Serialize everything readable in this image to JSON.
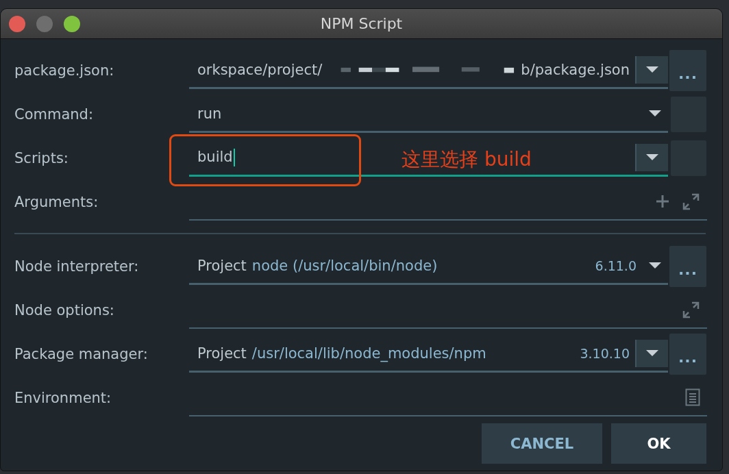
{
  "window": {
    "title": "NPM Script"
  },
  "general": [
    {
      "label": "package.json:",
      "kind": "path",
      "value_start": "orkspace/project/",
      "value_end": "b/package.json",
      "arrow_boxed": true,
      "side": {
        "kind": "browse",
        "label": "..."
      }
    },
    {
      "label": "Command:",
      "kind": "dropdown",
      "value": "run",
      "arrow_boxed": false,
      "side": {
        "kind": "blank"
      }
    },
    {
      "label": "Scripts:",
      "kind": "editable",
      "value": "build",
      "focused": true,
      "arrow_boxed": true,
      "side": {
        "kind": "blank"
      }
    },
    {
      "label": "Arguments:",
      "kind": "arguments"
    }
  ],
  "node": [
    {
      "label": "Node interpreter:",
      "kind": "interpreter",
      "prefix": "Project",
      "value": "node (/usr/local/bin/node)",
      "version": "6.11.0",
      "arrow_boxed": false,
      "side": {
        "kind": "browse",
        "label": "..."
      }
    },
    {
      "label": "Node options:",
      "kind": "options"
    },
    {
      "label": "Package manager:",
      "kind": "interpreter",
      "prefix": "Project",
      "value": "/usr/local/lib/node_modules/npm",
      "version": "3.10.10",
      "arrow_boxed": true,
      "side": {
        "kind": "browse",
        "label": "..."
      }
    },
    {
      "label": "Environment:",
      "kind": "environment"
    }
  ],
  "annotation": {
    "text": "这里选择 build"
  },
  "buttons": [
    {
      "label": "CANCEL",
      "default": false
    },
    {
      "label": "OK",
      "default": true
    }
  ]
}
